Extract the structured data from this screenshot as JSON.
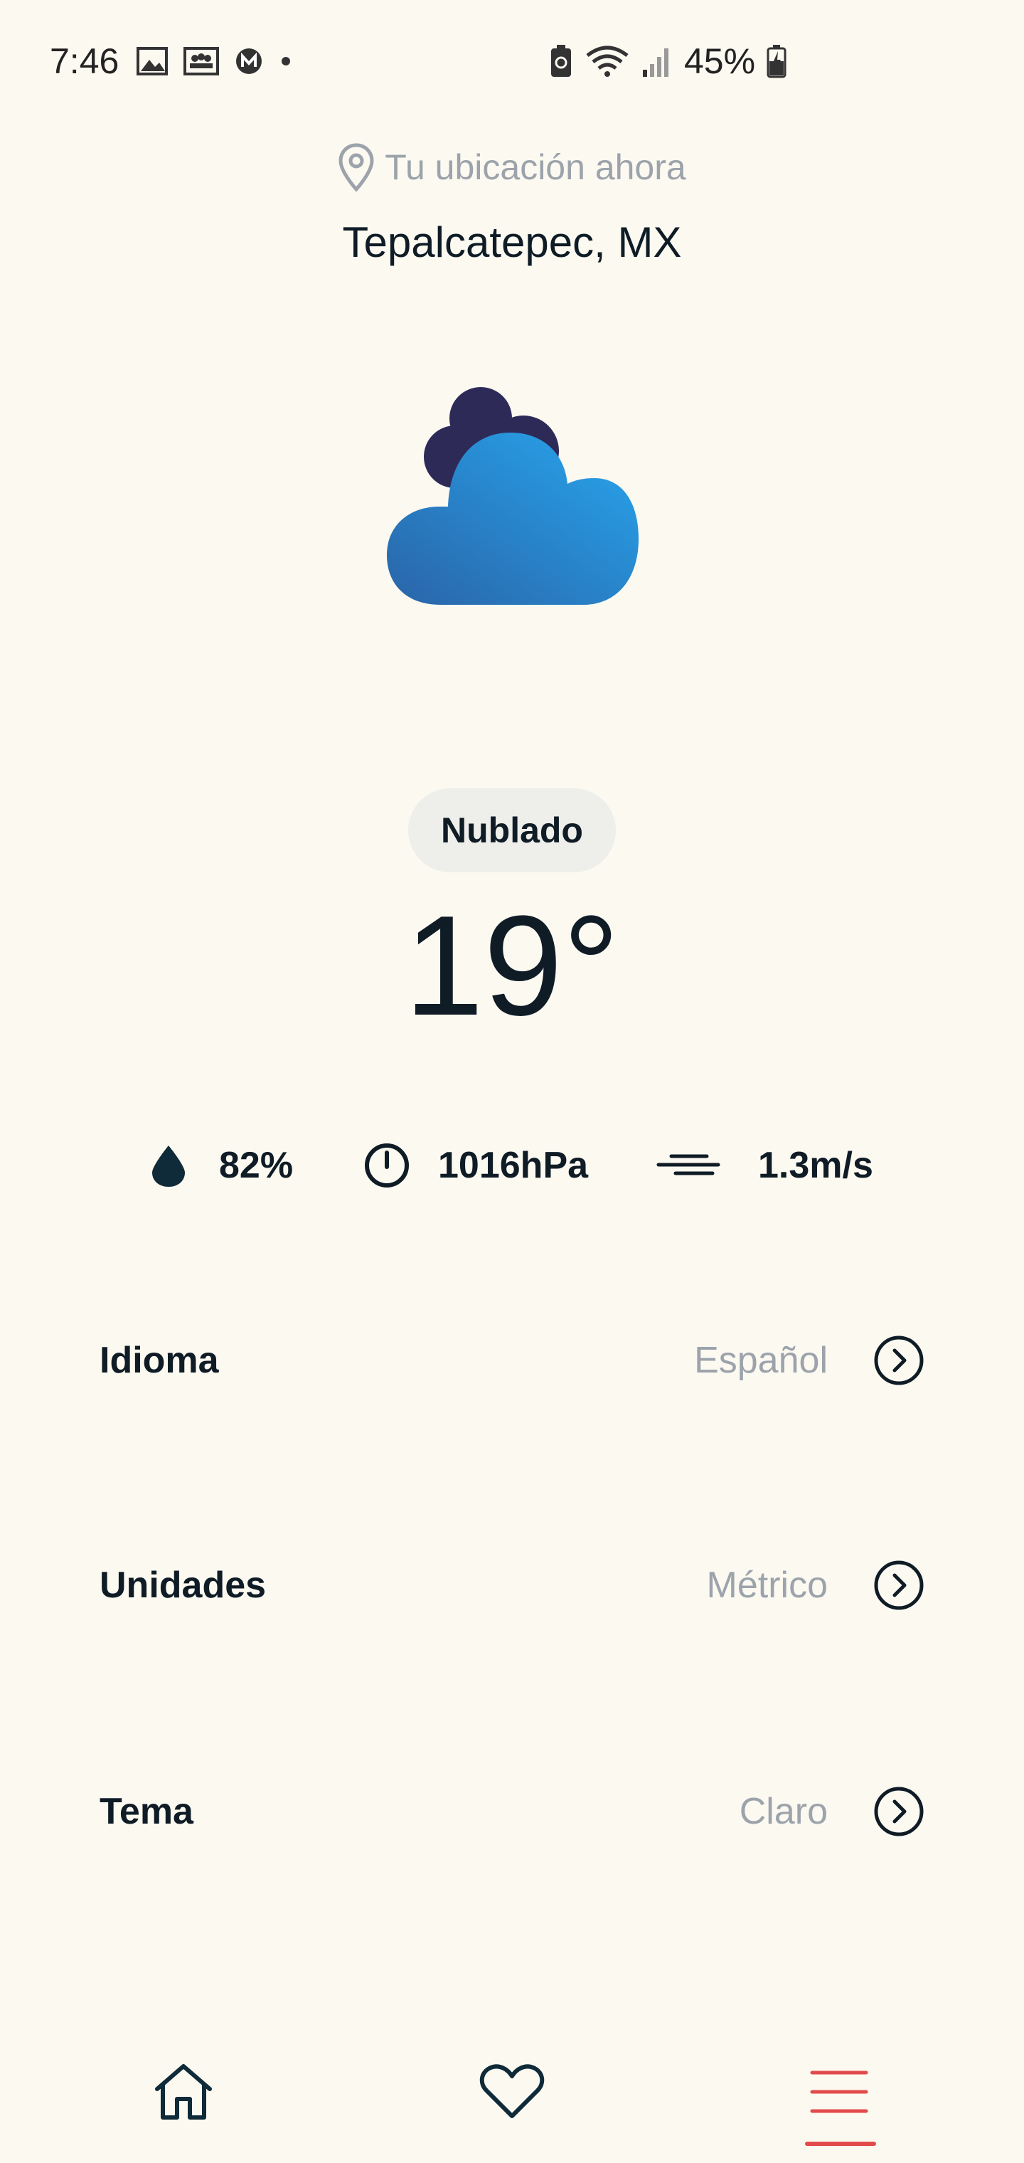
{
  "status_bar": {
    "time": "7:46",
    "battery": "45%",
    "left_icons": [
      "gallery-icon",
      "group-icon",
      "m-app-icon",
      "dot-icon"
    ],
    "right_icons": [
      "battery-saver-icon",
      "wifi-icon",
      "signal-icon",
      "battery-charging-icon"
    ]
  },
  "location": {
    "hint": "Tu ubicación ahora",
    "city": "Tepalcatepec, MX"
  },
  "weather": {
    "icon": "cloudy-icon",
    "condition": "Nublado",
    "temperature": "19°"
  },
  "stats": {
    "humidity": "82%",
    "pressure": "1016hPa",
    "wind": "1.3m/s"
  },
  "settings": [
    {
      "label": "Idioma",
      "value": "Español"
    },
    {
      "label": "Unidades",
      "value": "Métrico"
    },
    {
      "label": "Tema",
      "value": "Claro"
    }
  ],
  "nav": {
    "items": [
      "home-icon",
      "heart-icon",
      "menu-icon"
    ],
    "active": "menu-icon"
  },
  "colors": {
    "background": "#fcf9f1",
    "text": "#0f1c26",
    "muted": "#9ca3ab",
    "accent": "#e24b4b",
    "cloud_front": "#2a8fd8",
    "cloud_back": "#2e2a58"
  }
}
